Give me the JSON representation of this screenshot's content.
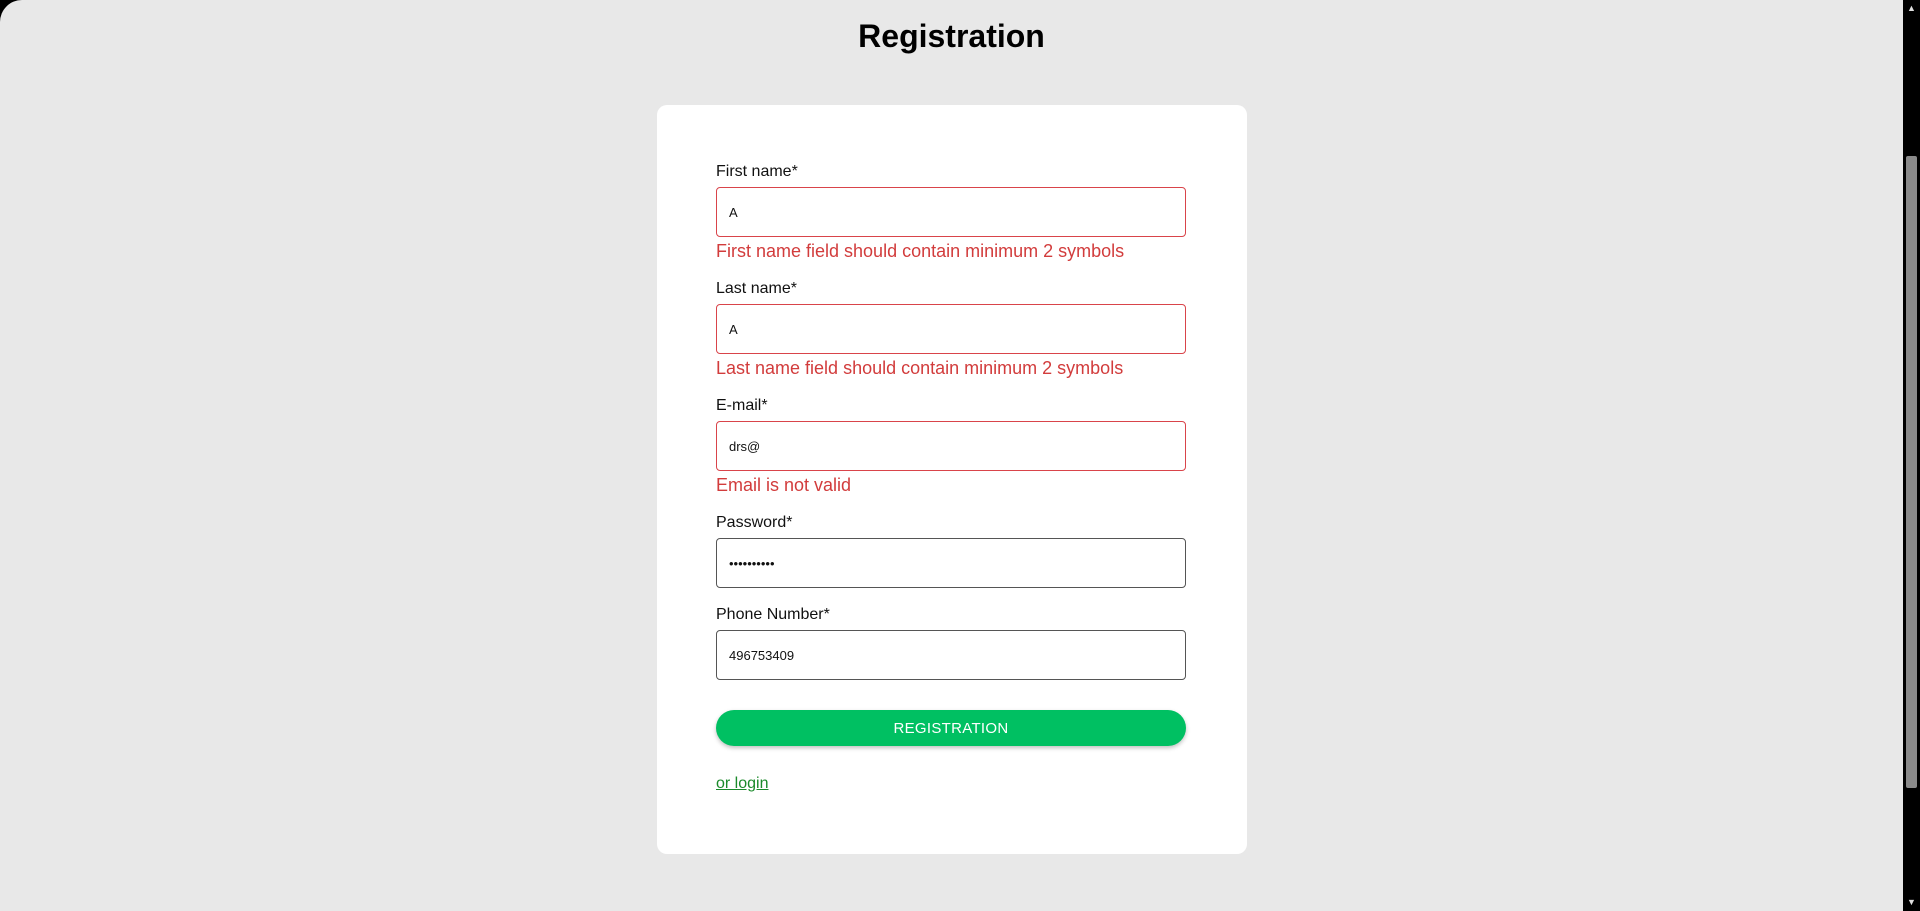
{
  "page": {
    "title": "Registration"
  },
  "form": {
    "first_name": {
      "label": "First name*",
      "value": "A",
      "error": "First name field should contain minimum 2 symbols"
    },
    "last_name": {
      "label": "Last name*",
      "value": "A",
      "error": "Last name field should contain minimum 2 symbols"
    },
    "email": {
      "label": "E-mail*",
      "value": "drs@",
      "error": "Email is not valid"
    },
    "password": {
      "label": "Password*",
      "value": "••••••••••"
    },
    "phone": {
      "label": "Phone Number*",
      "value": "496753409"
    },
    "submit_label": "REGISTRATION",
    "login_link": "or login"
  },
  "scrollbar": {
    "up_arrow": "▲",
    "down_arrow": "▼"
  },
  "colors": {
    "background": "#e8e8e8",
    "card": "#ffffff",
    "error": "#d23c3c",
    "accent": "#00c062",
    "link": "#1a8a2a"
  }
}
